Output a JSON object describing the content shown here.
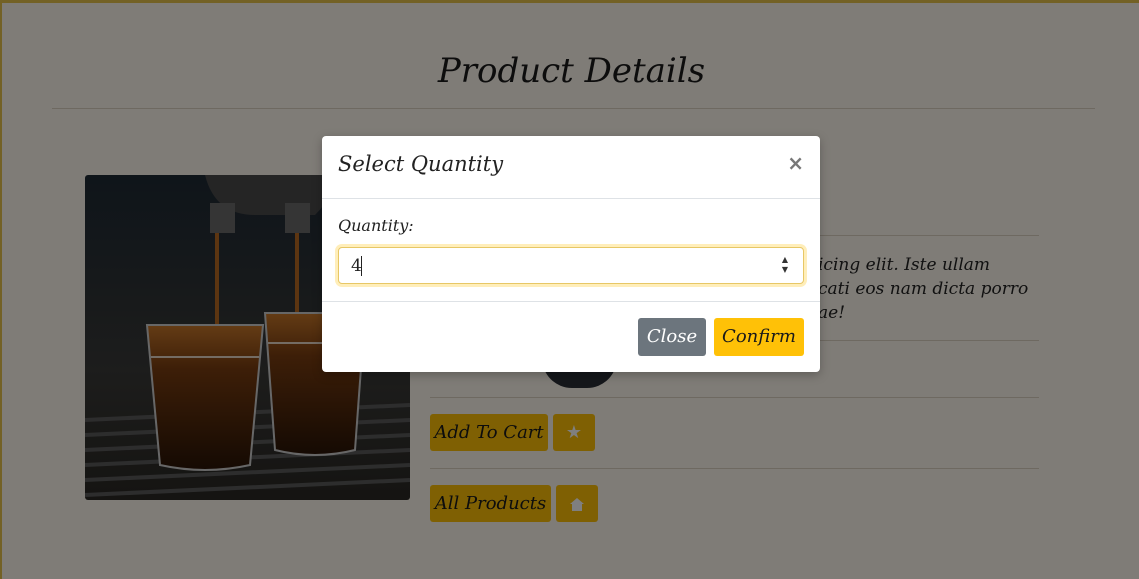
{
  "page": {
    "title": "Product Details",
    "description_visible": "icing elit. Iste ullam\ncati eos nam dicta porro\nae!"
  },
  "actions": {
    "add_to_cart": "Add To Cart",
    "favorite_icon": "star-icon",
    "all_products": "All Products",
    "home_icon": "home-icon"
  },
  "modal": {
    "title": "Select Quantity",
    "close_x": "×",
    "quantity_label": "Quantity:",
    "quantity_value": "4",
    "close_button": "Close",
    "confirm_button": "Confirm"
  },
  "colors": {
    "accent": "#ffc107",
    "secondary": "#6c757d",
    "page_bg": "#fff9ef"
  }
}
